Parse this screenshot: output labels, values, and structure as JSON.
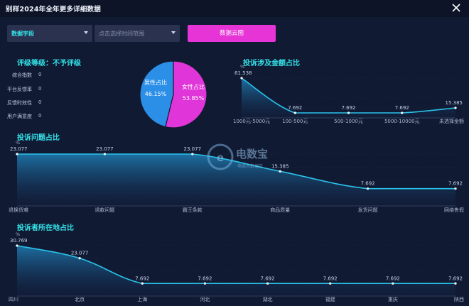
{
  "window": {
    "title": "别样2024年全年更多详细数据"
  },
  "filters": {
    "field_select": {
      "value": "数据字段"
    },
    "time_select": {
      "placeholder": "点击选择时间范围"
    },
    "cloud_button": "数据云图"
  },
  "grade": {
    "title": "评级等级：不予评级",
    "rows": [
      {
        "label": "综合指数",
        "value": "0"
      },
      {
        "label": "平台反馈率",
        "value": "0"
      },
      {
        "label": "反馈时效性",
        "value": "0"
      },
      {
        "label": "用户满意度",
        "value": "0"
      }
    ]
  },
  "watermark": {
    "logo_text": "电数宝",
    "sub_text": "电商大数据库"
  },
  "colors": {
    "background": "#111a33",
    "accent_cyan": "#34e4ea",
    "accent_magenta": "#e634d6",
    "male_blue": "#2b8fe8",
    "female_pink": "#e035d8"
  },
  "chart_data": [
    {
      "type": "pie",
      "slices": [
        {
          "name": "男性占比",
          "value": 46.15,
          "label": "46.15%"
        },
        {
          "name": "女性占比",
          "value": 53.85,
          "label": "53.85%"
        }
      ]
    },
    {
      "type": "area",
      "title": "投诉涉及金额占比",
      "unit": "%",
      "categories": [
        "1000元-5000元",
        "100-500元",
        "500-1000元",
        "5000-10000元",
        "未选择金额"
      ],
      "values": [
        61.538,
        7.692,
        7.692,
        7.692,
        15.385
      ],
      "labels": [
        "61.538",
        "7.692",
        "7.692",
        "7.692",
        "15.385"
      ],
      "ylim": [
        0,
        61.538
      ]
    },
    {
      "type": "area",
      "title": "投诉问题占比",
      "unit": "%",
      "categories": [
        "退换货难",
        "退款问题",
        "霸王条款",
        "商品质量",
        "发货问题",
        "网络售假"
      ],
      "values": [
        23.077,
        23.077,
        23.077,
        15.385,
        7.692,
        7.692
      ],
      "labels": [
        "23.077",
        "23.077",
        "23.077",
        "15.385",
        "7.692",
        "7.692"
      ],
      "ylim": [
        0,
        23.077
      ]
    },
    {
      "type": "area",
      "title": "投诉者所在地占比",
      "unit": "%",
      "categories": [
        "四川",
        "北京",
        "上海",
        "河北",
        "湖北",
        "福建",
        "重庆",
        "陕西"
      ],
      "values": [
        30.769,
        23.077,
        7.692,
        7.692,
        7.692,
        7.692,
        7.692,
        7.692
      ],
      "labels": [
        "30.769",
        "23.077",
        "7.692",
        "7.692",
        "7.692",
        "7.692",
        "7.692",
        "7.692"
      ],
      "ylim": [
        0,
        30.769
      ]
    }
  ]
}
